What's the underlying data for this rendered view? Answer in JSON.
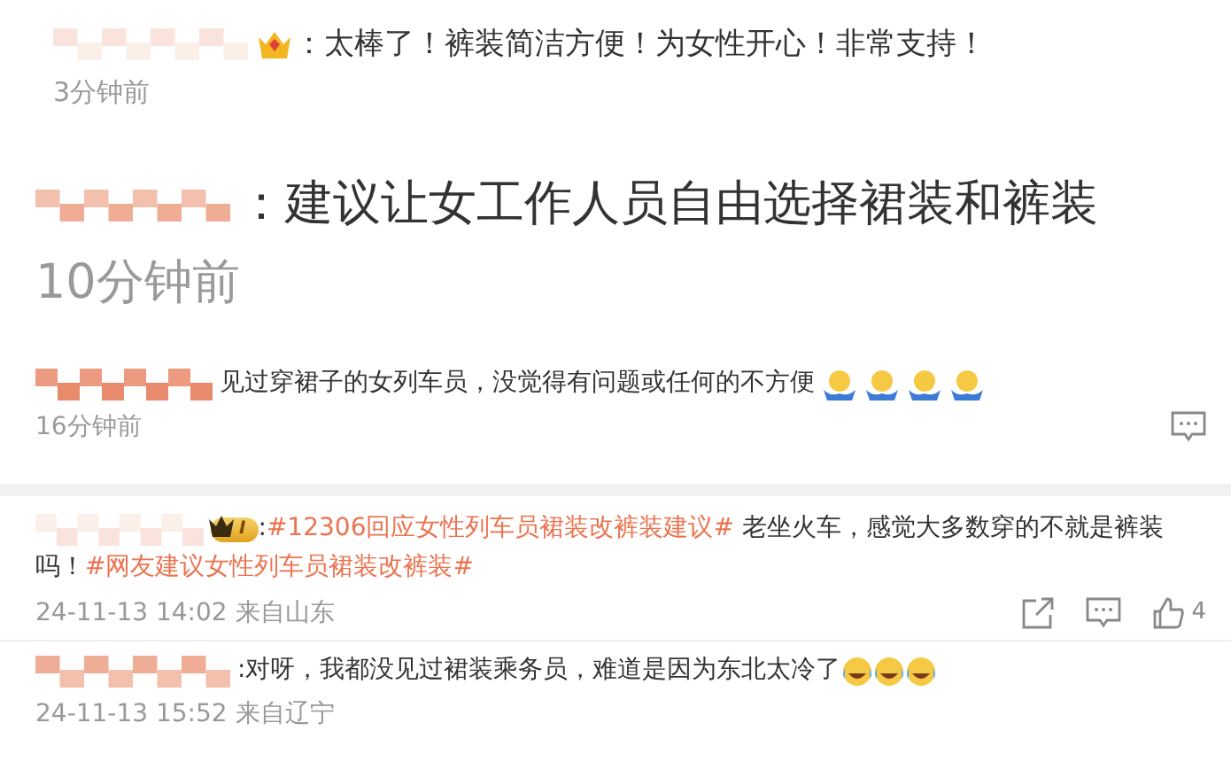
{
  "comments": [
    {
      "kind": "medium",
      "badge": {
        "kind": "crown"
      },
      "lines": [
        [
          {
            "kind": "plain",
            "text": "：太棒了！裤装简洁方便！为女性开心！非常支持！"
          }
        ]
      ],
      "time": "3分钟前"
    },
    {
      "kind": "large",
      "lines": [
        [
          {
            "kind": "plain",
            "text": "：建议让女工作人员自由选择裙装和裤装"
          }
        ]
      ],
      "time": "10分钟前"
    },
    {
      "kind": "small",
      "lines": [
        [
          {
            "kind": "plain",
            "text": "见过穿裙子的女列车员，没觉得有问题或任何的不方便"
          }
        ]
      ],
      "emojis": [
        {
          "kind": "shrug"
        },
        {
          "kind": "shrug"
        },
        {
          "kind": "shrug"
        },
        {
          "kind": "shrug"
        }
      ],
      "time": "16分钟前",
      "actions": [
        {
          "kind": "comment"
        }
      ]
    },
    {
      "kind": "small",
      "badge": {
        "kind": "level",
        "label": "I"
      },
      "lines": [
        [
          {
            "kind": "plain",
            "text": ":"
          },
          {
            "kind": "topic",
            "text": "#12306回应女性列车员裙装改裤装建议#"
          },
          {
            "kind": "plain",
            "text": " 老坐火车，感觉大多数穿的不就是裤装"
          }
        ],
        [
          {
            "kind": "plain",
            "text": "吗！"
          },
          {
            "kind": "topic",
            "text": "#网友建议女性列车员裙装改裤装#"
          }
        ]
      ],
      "time": "24-11-13 14:02 来自山东",
      "actions": [
        {
          "kind": "share"
        },
        {
          "kind": "comment"
        },
        {
          "kind": "like",
          "count": "4"
        }
      ]
    },
    {
      "kind": "small",
      "lines": [
        [
          {
            "kind": "plain",
            "text": ":对呀，我都没见过裙装乘务员，难道是因为东北太冷了"
          }
        ]
      ],
      "emojis": [
        {
          "kind": "laugh"
        },
        {
          "kind": "laugh"
        },
        {
          "kind": "laugh"
        }
      ],
      "time": "24-11-13 15:52 来自辽宁"
    }
  ]
}
